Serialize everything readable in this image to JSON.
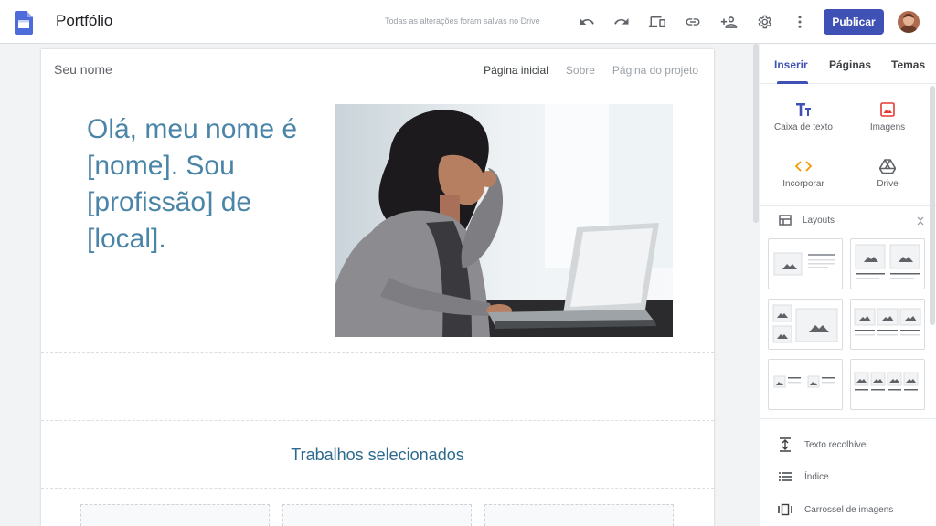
{
  "topbar": {
    "title": "Portfólio",
    "save_status": "Todas as alterações foram salvas no Drive",
    "publish_label": "Publicar",
    "icons": [
      "undo-icon",
      "redo-icon",
      "preview-icon",
      "link-icon",
      "share-icon",
      "settings-icon",
      "more-icon"
    ]
  },
  "site": {
    "name": "Seu nome",
    "nav": [
      "Página inicial",
      "Sobre",
      "Página do projeto"
    ],
    "hero_text": "Olá, meu nome é [nome]. Sou [profissão] de [local].",
    "section_title": "Trabalhos selecionados"
  },
  "panel": {
    "tabs": [
      "Inserir",
      "Páginas",
      "Temas"
    ],
    "insert": {
      "text_box": "Caixa de texto",
      "images": "Imagens",
      "embed": "Incorporar",
      "drive": "Drive"
    },
    "layouts_label": "Layouts",
    "list": {
      "collapsible": "Texto recolhível",
      "toc": "Índice",
      "carousel": "Carrossel de imagens"
    }
  },
  "colors": {
    "accent": "#3f51b5",
    "hero_text": "#4a85a8",
    "section_title": "#2d6a8e"
  }
}
